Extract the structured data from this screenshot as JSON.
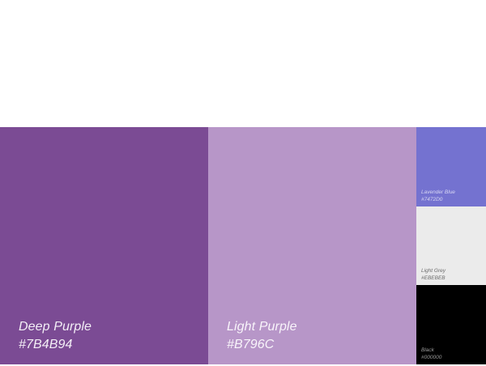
{
  "palette": {
    "colors": [
      {
        "name": "Deep Purple",
        "hex": "#7B4B94",
        "text_color": "#f3eef6"
      },
      {
        "name": "Light Purple",
        "hex": "#B796C",
        "text_color": "#f8f4fa"
      },
      {
        "name": "Lavender Blue",
        "hex": "#7472D0",
        "text_color": "#d8d7f3"
      },
      {
        "name": "Light Grey",
        "hex": "#EBEBEB",
        "text_color": "#6b6b6b"
      },
      {
        "name": "Black",
        "hex": "#000000",
        "text_color": "#9a9a9a"
      }
    ],
    "fill_colors": [
      "#7B4B94",
      "#B796C8",
      "#7472D0",
      "#EBEBEB",
      "#000000"
    ]
  }
}
